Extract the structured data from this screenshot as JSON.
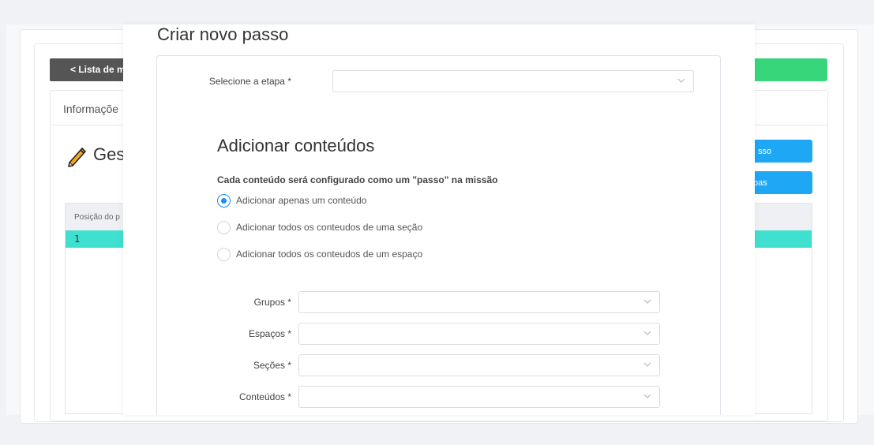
{
  "background": {
    "back_button": "< Lista de m",
    "panel_title": "Informaçõe",
    "heading": "Ges",
    "blue_button_1": "sso",
    "blue_button_2": "pas",
    "table": {
      "header": "Posição do p",
      "rows": [
        "1"
      ]
    },
    "colors": {
      "green": "#38d67a",
      "blue": "#1ea7f5",
      "row_highlight": "#40e0d0",
      "back_button": "#555555"
    }
  },
  "modal": {
    "title": "Criar novo passo",
    "stage": {
      "label": "Selecione a etapa *",
      "value": ""
    },
    "section_title": "Adicionar conteúdos",
    "section_subtitle": "Cada conteúdo será configurado como um \"passo\" na missão",
    "options": [
      {
        "label": "Adicionar apenas um conteúdo",
        "selected": true
      },
      {
        "label": "Adicionar todos os conteudos de uma seção",
        "selected": false
      },
      {
        "label": "Adicionar todos os conteudos de um espaço",
        "selected": false
      }
    ],
    "fields": {
      "groups": {
        "label": "Grupos *",
        "value": ""
      },
      "spaces": {
        "label": "Espaços *",
        "value": ""
      },
      "sections": {
        "label": "Seções *",
        "value": ""
      },
      "contents": {
        "label": "Conteúdos *",
        "value": ""
      }
    },
    "accent_color": "#1a8cff"
  }
}
